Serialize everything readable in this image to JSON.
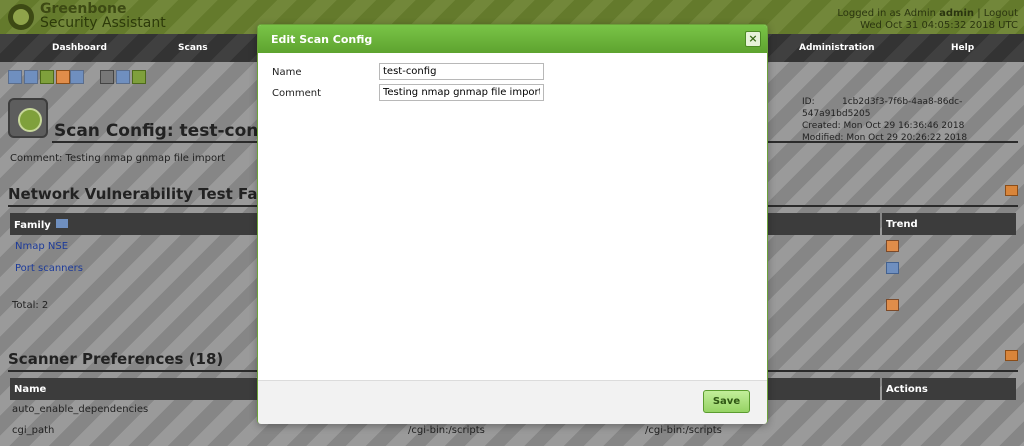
{
  "header": {
    "brand_line1": "Greenbone",
    "brand_line2": "Security Assistant",
    "logged_in_prefix": "Logged in as",
    "role": "Admin",
    "username": "admin",
    "separator": "|",
    "logout": "Logout",
    "datetime": "Wed Oct 31 04:05:32 2018 UTC"
  },
  "nav": {
    "items": [
      "Dashboard",
      "Scans",
      "Administration",
      "Help"
    ]
  },
  "page": {
    "title": "Scan Config: test-conf",
    "comment": "Comment: Testing nmap gnmap file import",
    "meta": {
      "id_label": "ID:",
      "id_value": "1cb2d3f3-7f6b-4aa8-86dc-547a91bd5205",
      "created_label": "Created:",
      "created_value": "Mon Oct 29 16:36:46 2018",
      "modified_label": "Modified:",
      "modified_value": "Mon Oct 29 20:26:22 2018"
    }
  },
  "nvt_section": {
    "title": "Network Vulnerability Test Fa",
    "col_family": "Family",
    "col_trend": "Trend",
    "rows": [
      {
        "family": "Nmap NSE"
      },
      {
        "family": "Port scanners"
      }
    ],
    "total": "Total: 2"
  },
  "prefs_section": {
    "title": "Scanner Preferences (18)",
    "col_name": "Name",
    "col_actions": "Actions",
    "rows": [
      {
        "name": "auto_enable_dependencies",
        "value1": "",
        "value2": ""
      },
      {
        "name": "cgi_path",
        "value1": "/cgi-bin:/scripts",
        "value2": "/cgi-bin:/scripts"
      }
    ]
  },
  "dialog": {
    "title": "Edit Scan Config",
    "close_glyph": "×",
    "name_label": "Name",
    "name_value": "test-config",
    "comment_label": "Comment",
    "comment_value": "Testing nmap gnmap file import",
    "save_label": "Save"
  },
  "colors": {
    "header_green": "#6a7f2f",
    "dialog_green": "#6ab43a",
    "link_blue": "#1d3b9a"
  }
}
